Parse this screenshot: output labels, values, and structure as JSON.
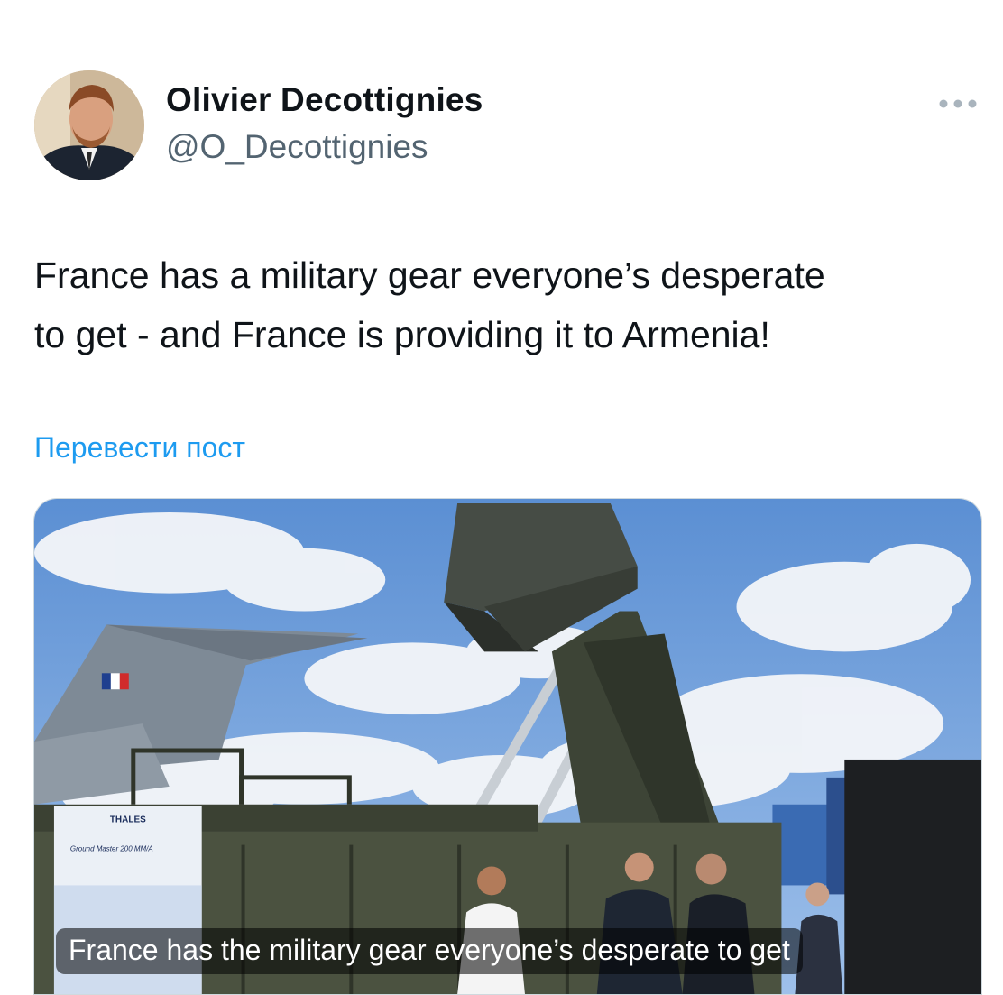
{
  "author": {
    "display_name": "Olivier Decottignies",
    "handle": "@O_Decottignies"
  },
  "tweet": {
    "text_line_1": "France has a military gear everyone’s desperate",
    "text_line_2": "to get - and France is providing it to Armenia!",
    "translate_label": "Перевести пост"
  },
  "media": {
    "caption": "France has the military gear everyone’s desperate to get",
    "banner_brand": "THALES",
    "banner_title": "Ground Master 200 MM/A"
  },
  "icons": {
    "more": "more-options-icon"
  },
  "colors": {
    "link": "#1d9bf0",
    "text_primary": "#0f1419",
    "text_secondary": "#536471"
  }
}
